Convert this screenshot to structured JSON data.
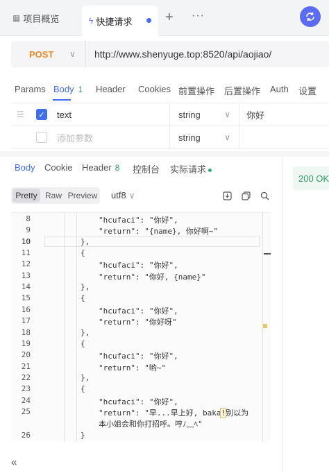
{
  "tabs": {
    "overview": "项目概览",
    "quick": "快捷请求"
  },
  "request": {
    "method": "POST",
    "url": "http://www.shenyuge.top:8520/api/aojiao/"
  },
  "request_tabs": [
    {
      "label": "Params"
    },
    {
      "label": "Body",
      "badge": "1"
    },
    {
      "label": "Header"
    },
    {
      "label": "Cookies"
    },
    {
      "label": "前置操作"
    },
    {
      "label": "后置操作"
    },
    {
      "label": "Auth"
    },
    {
      "label": "设置"
    }
  ],
  "params": [
    {
      "name": "text",
      "type": "string",
      "value": "你好"
    },
    {
      "name_placeholder": "添加参数",
      "type": "string"
    }
  ],
  "response_tabs": [
    {
      "label": "Body"
    },
    {
      "label": "Cookie"
    },
    {
      "label": "Header",
      "badge": "8"
    },
    {
      "label": "控制台"
    },
    {
      "label": "实际请求"
    }
  ],
  "status": "200 OK",
  "format": {
    "modes": [
      "Pretty",
      "Raw",
      "Preview"
    ],
    "active": "Pretty",
    "encoding": "utf8"
  },
  "code_lines": [
    {
      "n": "8",
      "text": "\"hcufaci\": \"你好\","
    },
    {
      "n": "9",
      "text": "\"return\": \"{name}, 你好啊~\""
    },
    {
      "n": "10",
      "text": "},"
    },
    {
      "n": "11",
      "text": "{"
    },
    {
      "n": "12",
      "text": "\"hcufaci\": \"你好\","
    },
    {
      "n": "13",
      "text": "\"return\": \"你好, {name}\""
    },
    {
      "n": "14",
      "text": "},"
    },
    {
      "n": "15",
      "text": "{"
    },
    {
      "n": "16",
      "text": "\"hcufaci\": \"你好\","
    },
    {
      "n": "17",
      "text": "\"return\": \"你好呀\""
    },
    {
      "n": "18",
      "text": "},"
    },
    {
      "n": "19",
      "text": "{"
    },
    {
      "n": "20",
      "text": "\"hcufaci\": \"你好\","
    },
    {
      "n": "21",
      "text": "\"return\": \"哟~\""
    },
    {
      "n": "22",
      "text": "},"
    },
    {
      "n": "23",
      "text": "{"
    },
    {
      "n": "24",
      "text": "\"hcufaci\": \"你好\","
    },
    {
      "n": "25",
      "text_a": "\"return\": \"早...早上好, baka",
      "text_hl": "!",
      "text_b": "别以为",
      "text_wrap": "本小姐会和你打招呼。哼ﾉ﹏ﾍ\""
    },
    {
      "n": "26",
      "text": "}"
    }
  ],
  "colors": {
    "accent": "#3f6ee8",
    "method": "#e8892b",
    "success": "#2e9d6a"
  }
}
